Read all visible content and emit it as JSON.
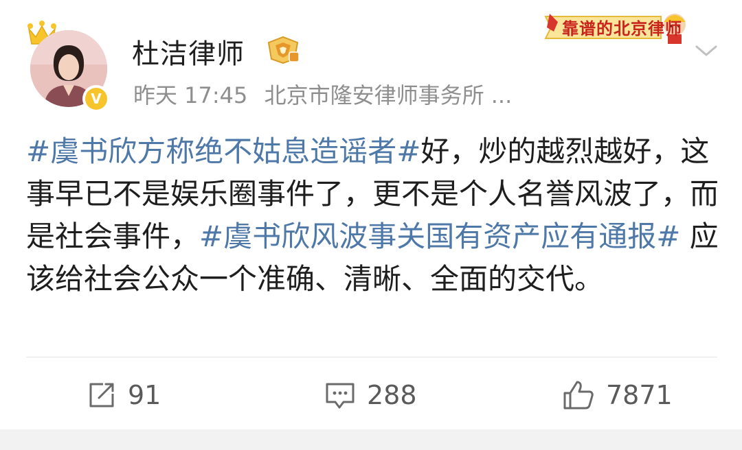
{
  "author": {
    "name": "杜洁律师",
    "verified_icon": "verified-check-icon",
    "rank_icon": "diamond-rank-badge-icon",
    "verified_symbol": "V"
  },
  "meta": {
    "time": "昨天 17:45",
    "source": "北京市隆安律师事务所 ..."
  },
  "banner": {
    "label": "靠谱的北京律师"
  },
  "post": {
    "tag1": "#虞书欣方称绝不姑息造谣者#",
    "text1": "好，炒的越烈越好，这事早已不是娱乐圈事件了，更不是个人名誉风波了，而是社会事件，",
    "tag2": "#虞书欣风波事关国有资产应有通报#",
    "text2": " 应该给社会公众一个准确、清晰、全面的交代。"
  },
  "actions": {
    "repost_count": "91",
    "comment_count": "288",
    "like_count": "7871"
  },
  "colors": {
    "tag": "#4d78a8",
    "text": "#1e1e1e",
    "meta": "#8e8e8e",
    "verified": "#f7c52b",
    "banner_red": "#c8231c"
  }
}
